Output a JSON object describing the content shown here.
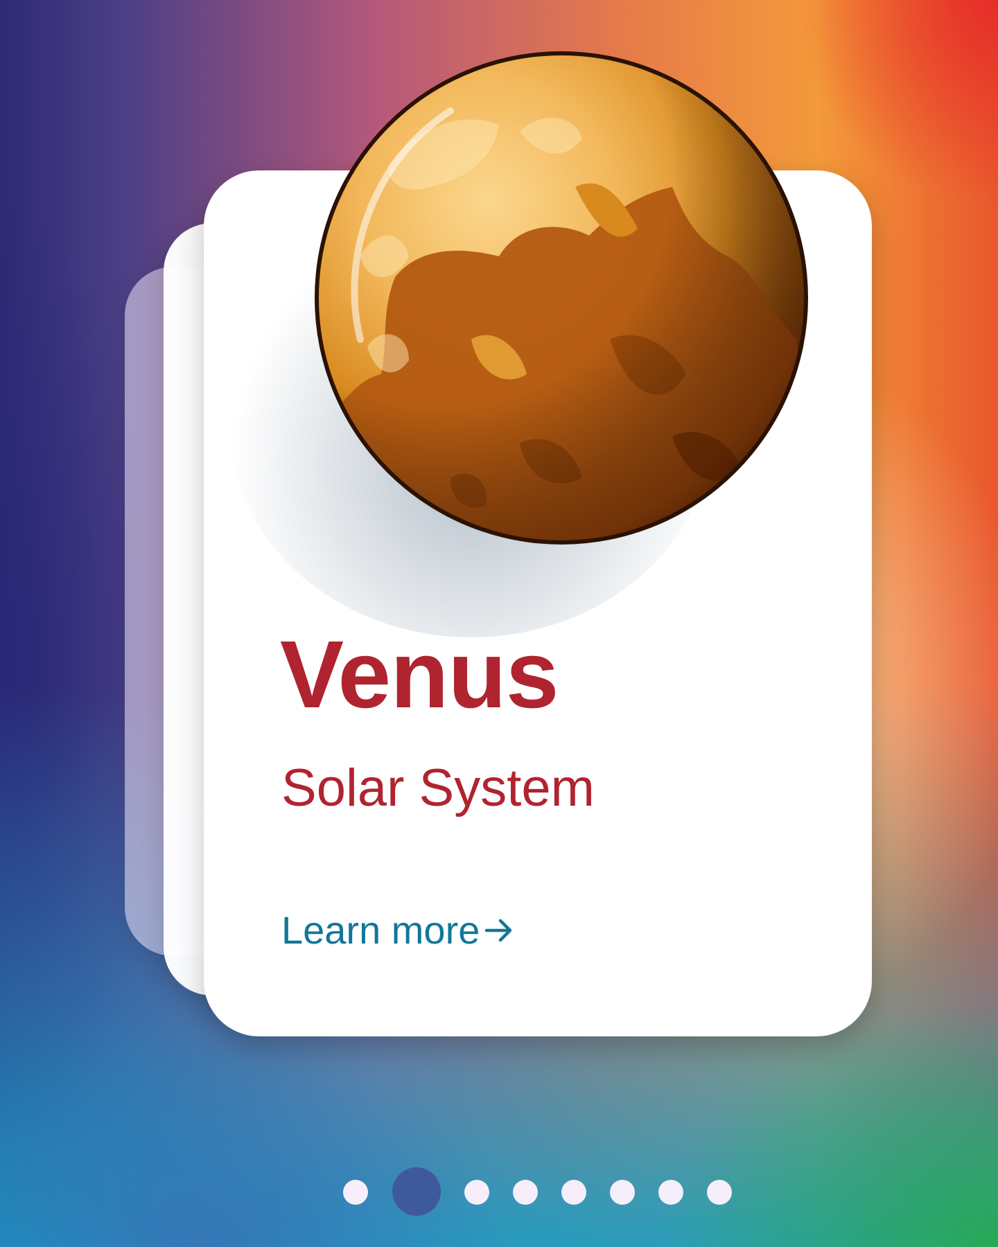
{
  "planet": {
    "name": "Venus",
    "category": "Solar System",
    "image_icon": "venus-planet-illustration"
  },
  "card": {
    "cta_label": "Learn more",
    "cta_icon": "arrow-right-icon"
  },
  "pagination": {
    "total": 8,
    "active_index": 1
  },
  "colors": {
    "title": "#b0242f",
    "cta": "#11779a",
    "dot": "#f6eefa",
    "dot_active": "#3f5a9c"
  }
}
